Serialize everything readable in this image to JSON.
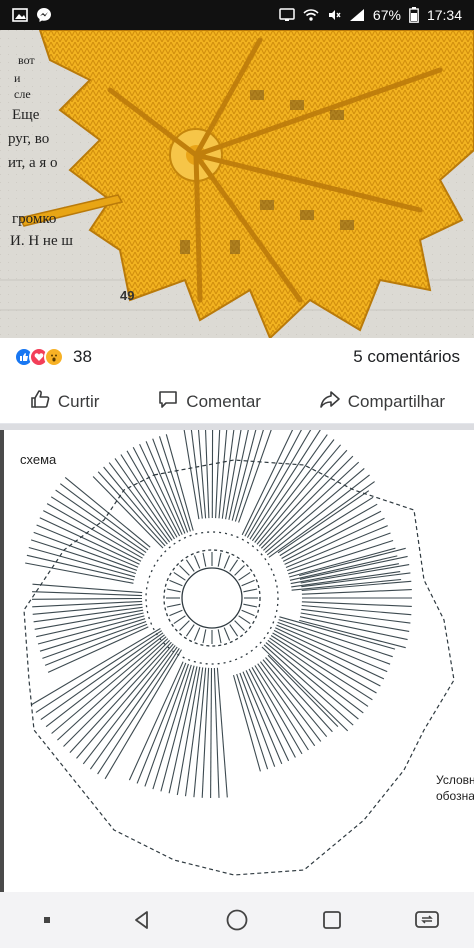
{
  "status_bar": {
    "battery": "67%",
    "time": "17:34"
  },
  "post": {
    "reaction_count": "38",
    "comments": "5 comentários",
    "actions": {
      "like": "Curtir",
      "comment": "Comentar",
      "share": "Compartilhar"
    }
  },
  "photo": {
    "book_text": [
      "вот",
      "и сле",
      "Еще",
      "руг, во",
      "ит, а я о",
      "громко",
      "И. Н не ш"
    ],
    "page_number": "49"
  },
  "diagram": {
    "title": "схема",
    "legend_lines": [
      "Условн",
      "обозна"
    ]
  },
  "colors": {
    "like": "#1877f2",
    "love": "#f33e58",
    "wow": "#f7b125",
    "yarn": "#f2b320"
  }
}
